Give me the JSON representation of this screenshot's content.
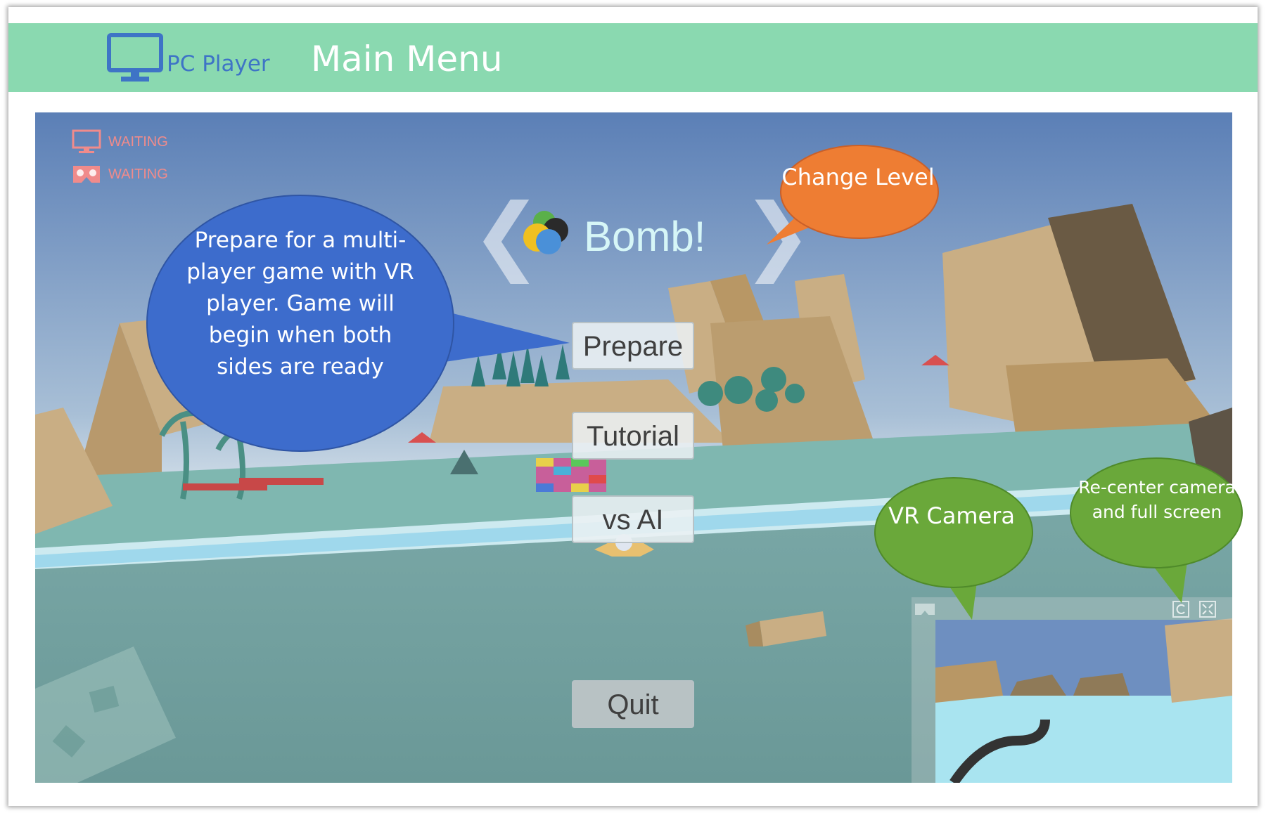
{
  "header": {
    "app_name": "PC Player",
    "title": "Main Menu",
    "icon": "monitor-icon",
    "color": "#8ad9b0"
  },
  "status": {
    "pc": {
      "icon": "monitor-icon",
      "text": "WAITING"
    },
    "vr": {
      "icon": "vr-headset-icon",
      "text": "WAITING"
    },
    "color": "#f08b8b"
  },
  "level": {
    "prev_icon": "chevron-left-icon",
    "next_icon": "chevron-right-icon",
    "name": "Bomb!",
    "icon": "bomb-balls-icon"
  },
  "menu": {
    "prepare": "Prepare",
    "tutorial": "Tutorial",
    "vs_ai": "vs AI",
    "quit": "Quit"
  },
  "vr_panel": {
    "camera_icon": "vr-headset-icon",
    "recenter_icon": "recenter-icon",
    "fullscreen_icon": "fullscreen-icon"
  },
  "callouts": {
    "prepare": "Prepare for a multi-player game with VR player. Game will begin when both sides are ready",
    "change_level": "Change Level",
    "vr_camera": "VR Camera",
    "recenter": "Re-center camera and full screen"
  },
  "colors": {
    "callout_blue": "#3d6ccc",
    "callout_orange": "#ee7d33",
    "callout_green": "#6aa83a"
  }
}
